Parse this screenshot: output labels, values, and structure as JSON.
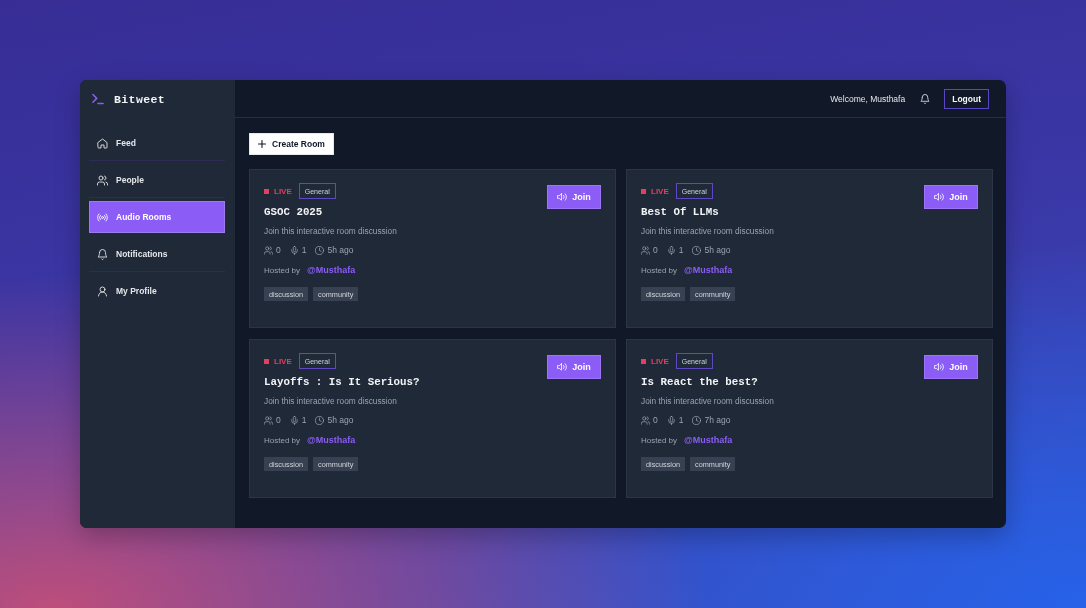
{
  "sidebar": {
    "brand": "Bitweet",
    "items": [
      {
        "label": "Feed",
        "selected": false
      },
      {
        "label": "People",
        "selected": false
      },
      {
        "label": "Audio Rooms",
        "selected": true
      },
      {
        "label": "Notifications",
        "selected": false
      },
      {
        "label": "My Profile",
        "selected": false
      }
    ]
  },
  "header": {
    "welcome": "Welcome, Musthafa",
    "logout_button": "Logout"
  },
  "create_room_button": "Create Room",
  "rooms": [
    {
      "status": "LIVE",
      "category": "General",
      "title": "GSOC 2025",
      "description": "Join this interactive room discussion",
      "listeners": "0",
      "speakers": "1",
      "time": "5h ago",
      "host_label": "Hosted by",
      "host": "@Musthafa",
      "tags": [
        "discussion",
        "community"
      ],
      "join_button": "Join"
    },
    {
      "status": "LIVE",
      "category": "General",
      "title": "Best Of LLMs",
      "description": "Join this interactive room discussion",
      "listeners": "0",
      "speakers": "1",
      "time": "5h ago",
      "host_label": "Hosted by",
      "host": "@Musthafa",
      "tags": [
        "discussion",
        "community"
      ],
      "join_button": "Join"
    },
    {
      "status": "LIVE",
      "category": "General",
      "title": "Layoffs : Is It Serious?",
      "description": "Join this interactive room discussion",
      "listeners": "0",
      "speakers": "1",
      "time": "5h ago",
      "host_label": "Hosted by",
      "host": "@Musthafa",
      "tags": [
        "discussion",
        "community"
      ],
      "join_button": "Join"
    },
    {
      "status": "LIVE",
      "category": "General",
      "title": "Is React the best?",
      "description": "Join this interactive room discussion",
      "listeners": "0",
      "speakers": "1",
      "time": "7h ago",
      "host_label": "Hosted by",
      "host": "@Musthafa",
      "tags": [
        "discussion",
        "community"
      ],
      "join_button": "Join"
    }
  ]
}
